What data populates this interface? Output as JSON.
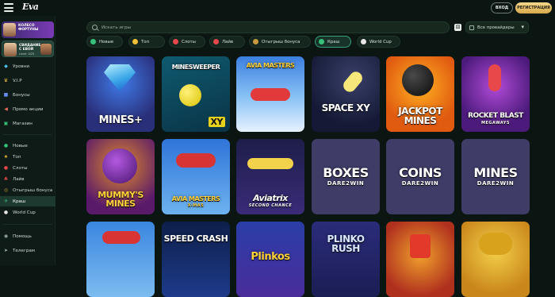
{
  "header": {
    "logo": "Eva",
    "login_label": "ВХОД",
    "register_label": "РЕГИСТРАЦИЯ"
  },
  "sidebar": {
    "promo_wheel": "КОЛЕСО ФОРТУНЫ",
    "promo_meet": "СВИДАНИЕ С ЕВОЙ",
    "promo_level": "Level: 0/25",
    "top_items": [
      {
        "label": "Уровни",
        "icon": "diamond-icon"
      },
      {
        "label": "V.I.P",
        "icon": "crown-icon"
      },
      {
        "label": "Бонусы",
        "icon": "gift-icon"
      },
      {
        "label": "Промо акции",
        "icon": "megaphone-icon"
      },
      {
        "label": "Магазин",
        "icon": "shop-icon"
      }
    ],
    "category_items": [
      {
        "label": "Новые",
        "icon": "new-icon"
      },
      {
        "label": "Топ",
        "icon": "star-icon"
      },
      {
        "label": "Слоты",
        "icon": "slots-icon"
      },
      {
        "label": "Лайв",
        "icon": "live-icon"
      },
      {
        "label": "Отыгрыш бонуса",
        "icon": "bonus-icon"
      },
      {
        "label": "Краш",
        "icon": "plane-icon"
      },
      {
        "label": "World Cup",
        "icon": "ball-icon"
      }
    ],
    "bottom_items": [
      {
        "label": "Помощь",
        "icon": "help-icon"
      },
      {
        "label": "Телеграм",
        "icon": "telegram-icon"
      }
    ]
  },
  "search": {
    "placeholder": "Искать игры",
    "providers_label": "Все провайдеры"
  },
  "chips": [
    {
      "label": "Новые",
      "color": "#36c27a"
    },
    {
      "label": "Топ",
      "color": "#f2c038"
    },
    {
      "label": "Слоты",
      "color": "#e5474b"
    },
    {
      "label": "Лайв",
      "color": "#e5474b"
    },
    {
      "label": "Отыгрыш бонуса",
      "color": "#c79a3f"
    },
    {
      "label": "Краш",
      "color": "#36c27a"
    },
    {
      "label": "World Cup",
      "color": "#e6e6e6"
    }
  ],
  "games": [
    {
      "title": "MINES+",
      "sub": ""
    },
    {
      "title": "MINESWEEPER",
      "sub": "XY"
    },
    {
      "title": "AVIA MASTERS",
      "sub": ""
    },
    {
      "title": "SPACE XY",
      "sub": ""
    },
    {
      "title": "JACKPOT MINES",
      "sub": ""
    },
    {
      "title": "ROCKET BLAST",
      "sub": "MEGAWAYS"
    },
    {
      "title": "MUMMY'S MINES",
      "sub": ""
    },
    {
      "title": "AVIA MASTERS",
      "sub": "X-MAS"
    },
    {
      "title": "Aviatrix",
      "sub": "SECOND CHANCE"
    },
    {
      "title": "BOXES",
      "sub": "DARE2WIN"
    },
    {
      "title": "COINS",
      "sub": "DARE2WIN"
    },
    {
      "title": "MINES",
      "sub": "DARE2WIN"
    },
    {
      "title": "",
      "sub": ""
    },
    {
      "title": "SPEED CRASH",
      "sub": ""
    },
    {
      "title": "Plinkos",
      "sub": ""
    },
    {
      "title": "PLINKO RUSH",
      "sub": ""
    },
    {
      "title": "",
      "sub": ""
    },
    {
      "title": "",
      "sub": ""
    }
  ]
}
